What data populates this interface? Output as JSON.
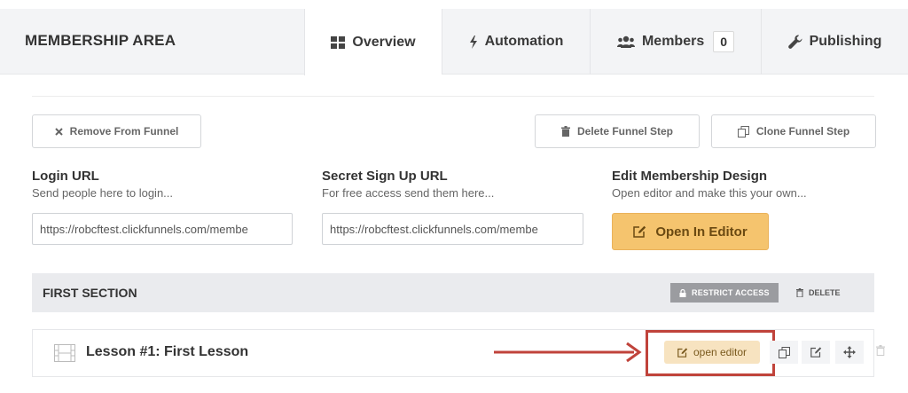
{
  "header": {
    "title": "MEMBERSHIP AREA",
    "tabs": [
      {
        "label": "Overview",
        "icon": "grid-icon",
        "active": true
      },
      {
        "label": "Automation",
        "icon": "bolt-icon",
        "active": false
      },
      {
        "label": "Members",
        "icon": "users-icon",
        "active": false,
        "badge": "0"
      },
      {
        "label": "Publishing",
        "icon": "wrench-icon",
        "active": false
      }
    ]
  },
  "actions": {
    "remove_label": "Remove From Funnel",
    "delete_step_label": "Delete Funnel Step",
    "clone_step_label": "Clone Funnel Step"
  },
  "login": {
    "title": "Login URL",
    "subtitle": "Send people here to login...",
    "value": "https://robcftest.clickfunnels.com/membe"
  },
  "signup": {
    "title": "Secret Sign Up URL",
    "subtitle": "For free access send them here...",
    "value": "https://robcftest.clickfunnels.com/membe"
  },
  "design": {
    "title": "Edit Membership Design",
    "subtitle": "Open editor and make this your own...",
    "button_label": "Open In Editor"
  },
  "section": {
    "title": "FIRST SECTION",
    "restrict_label": "RESTRICT ACCESS",
    "delete_label": "DELETE"
  },
  "lesson": {
    "title": "Lesson #1: First Lesson",
    "open_editor_label": "open editor"
  },
  "colors": {
    "accent": "#f5c46e",
    "highlight": "#c0433b",
    "header_bg": "#f3f4f6"
  }
}
